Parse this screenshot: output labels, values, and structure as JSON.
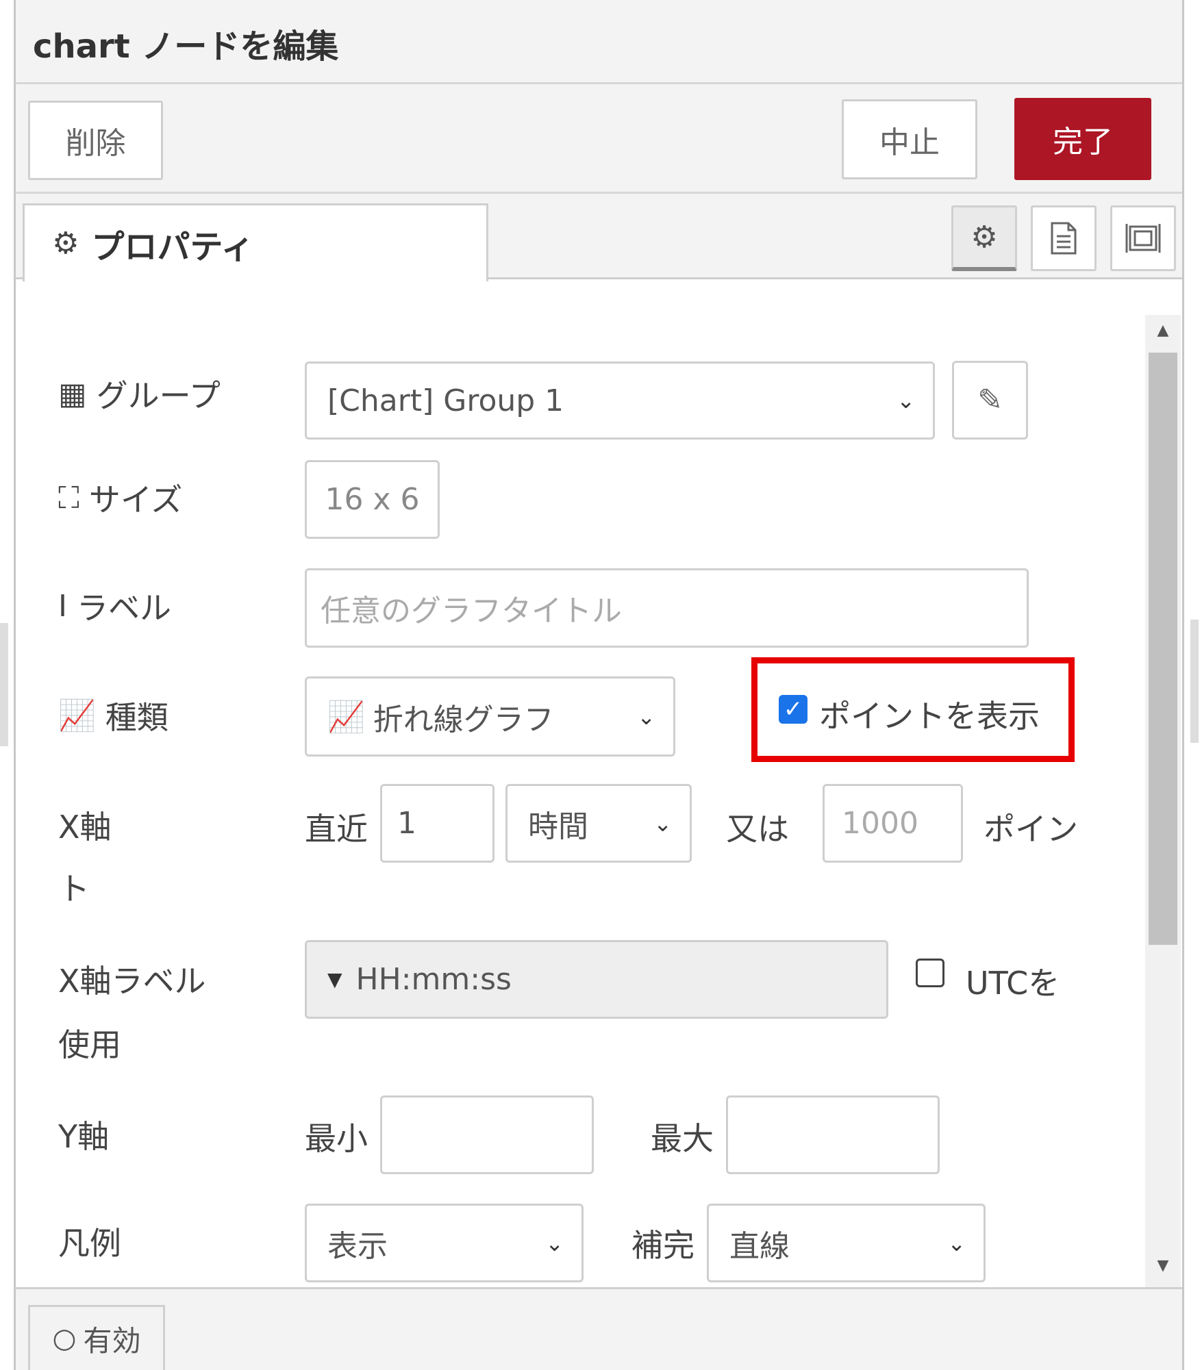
{
  "dialog": {
    "title": "chart ノードを編集"
  },
  "toolbar": {
    "delete_label": "削除",
    "cancel_label": "中止",
    "done_label": "完了"
  },
  "tabs": {
    "properties_label": "プロパティ",
    "icons": [
      "gear-icon",
      "description-icon",
      "appearance-icon"
    ]
  },
  "form": {
    "group": {
      "label": "グループ",
      "value": "[Chart] Group 1"
    },
    "size": {
      "label": "サイズ",
      "value": "16 x 6"
    },
    "chart_label": {
      "label": "ラベル",
      "placeholder": "任意のグラフタイトル"
    },
    "type": {
      "label": "種類",
      "value": "折れ線グラフ",
      "show_points_label": "ポイントを表示",
      "show_points_checked": true
    },
    "x_axis": {
      "label": "X軸",
      "label_wrap": "ト",
      "last_label": "直近",
      "last_value": "1",
      "unit_value": "時間",
      "or_label": "又は",
      "points_placeholder": "1000",
      "points_label": "ポイン"
    },
    "x_axis_label": {
      "label": "X軸ラベル",
      "label_wrap": "使用",
      "value": "HH:mm:ss",
      "utc_label": "UTCを",
      "utc_checked": false
    },
    "y_axis": {
      "label": "Y軸",
      "min_label": "最小",
      "min_value": "",
      "max_label": "最大",
      "max_value": ""
    },
    "legend": {
      "label": "凡例",
      "value": "表示",
      "interpolate_label": "補完",
      "interpolate_value": "直線"
    }
  },
  "footer": {
    "enabled_label": "有効"
  },
  "colors": {
    "primary_button": "#ad1625",
    "highlight_box": "#e60000",
    "checkbox_checked": "#1a73e8"
  }
}
